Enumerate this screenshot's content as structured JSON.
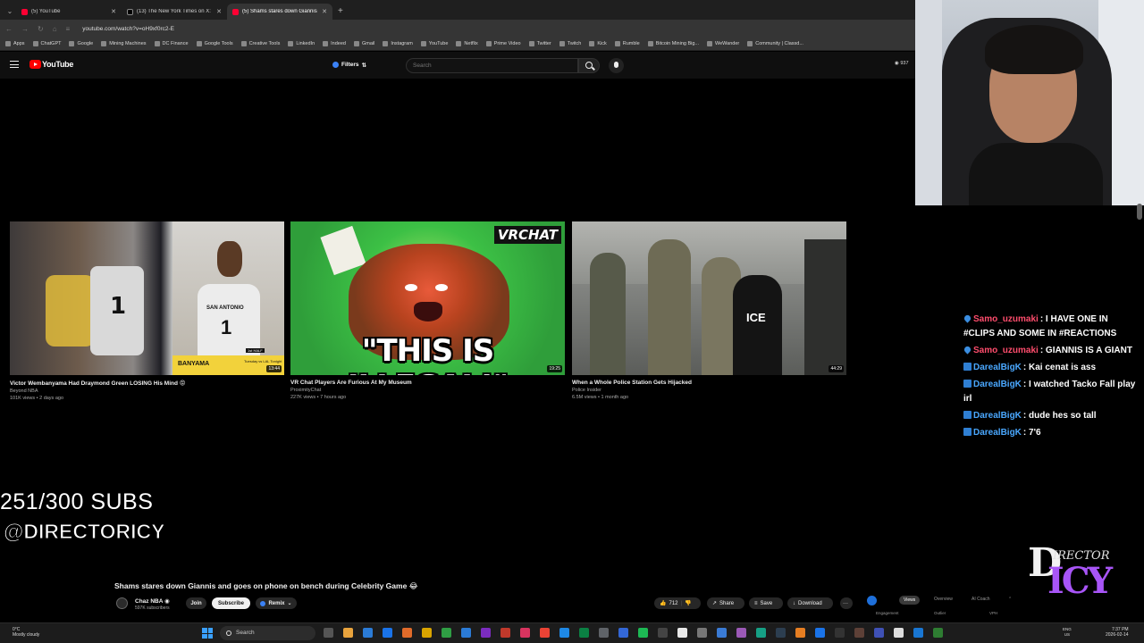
{
  "browser": {
    "tabs": [
      {
        "title": "(5) YouTube",
        "icon": "youtube-icon"
      },
      {
        "title": "(13) The New York Times on X:",
        "icon": "x-icon"
      },
      {
        "title": "(5) Shams stares down Giannis",
        "icon": "youtube-icon",
        "active": true
      }
    ],
    "url": "youtube.com/watch?v=oH9xf0rc2-E",
    "bookmarks": [
      "Apps",
      "ChatGPT",
      "Google",
      "Mining Machines",
      "DC Finance",
      "Google Tools",
      "Creative Tools",
      "LinkedIn",
      "Indeed",
      "Gmail",
      "Instagram",
      "YouTube",
      "Netflix",
      "Prime Video",
      "Twitter",
      "Twitch",
      "Kick",
      "Rumble",
      "Bitcoin Mining Big...",
      "WeWander",
      "Community | Classd..."
    ]
  },
  "youtube": {
    "logo_text": "YouTube",
    "filters_label": "Filters",
    "search_placeholder": "Search",
    "header_views": "937",
    "videos": [
      {
        "title": "Victor Wembanyama Had Draymond Green LOSING His Mind 😡",
        "channel": "Beyond NBA",
        "meta": "101K views • 2 days ago",
        "duration": "13:44",
        "thumb_number": "1",
        "thumb_team": "SAN ANTONIO",
        "thumb_banner": "BANYAMA",
        "thumb_sub": "Tuesday vs LAL Tonight",
        "thumb_half": "1st HALF"
      },
      {
        "title": "VR Chat Players Are Furious At My Museum",
        "channel": "ProximityChat",
        "meta": "227K views • 7 hours ago",
        "duration": "19:25",
        "thumb_tag": "VRCHAT",
        "thumb_text": "\"THIS IS ILLEGAL!\""
      },
      {
        "title": "When a Whole Police Station Gets Hijacked",
        "channel": "Police Insider",
        "meta": "6.5M views • 1 month ago",
        "duration": "44:29",
        "thumb_text": "ICE"
      }
    ],
    "now_playing": {
      "title": "Shams stares down Giannis and goes on phone on bench during Celebrity Game 😂",
      "channel": "Chaz NBA",
      "subscribers": "597K subscribers",
      "join_label": "Join",
      "subscribe_label": "Subscribe",
      "remix_label": "Remix",
      "likes": "712",
      "share_label": "Share",
      "save_label": "Save",
      "download_label": "Download",
      "more_label": "···"
    },
    "analytics": {
      "tabs": [
        "Views",
        "Overview",
        "AI Coach"
      ],
      "sub": [
        "Engagement",
        "Outlier",
        "VPH"
      ]
    }
  },
  "overlay": {
    "subs_goal": "251/300 SUBS",
    "handle": "@DIRECTORICY",
    "logo_text": "DIRECTOR ICY"
  },
  "chat": [
    {
      "user": "Samo_uzumaki",
      "color": "red",
      "badge": "blue-drop",
      "text": ": I HAVE ONE IN #CLIPS AND SOME IN #REACTIONS"
    },
    {
      "user": "Samo_uzumaki",
      "color": "red",
      "badge": "blue-drop",
      "text": ": GIANNIS IS A GIANT"
    },
    {
      "user": "DarealBigK",
      "color": "blue",
      "badge": "twbadge",
      "text": ": Kai cenat is ass"
    },
    {
      "user": "DarealBigK",
      "color": "blue",
      "badge": "twbadge",
      "text": ": I watched Tacko Fall play irl"
    },
    {
      "user": "DarealBigK",
      "color": "blue",
      "badge": "twbadge",
      "text": ": dude hes so tall"
    },
    {
      "user": "DarealBigK",
      "color": "blue",
      "badge": "twbadge",
      "text": ": 7'6"
    }
  ],
  "taskbar": {
    "weather_temp": "0°C",
    "weather_desc": "Mostly cloudy",
    "search_label": "Search",
    "lang": "ENG",
    "region": "US",
    "time": "7:37 PM",
    "date": "2026-02-14"
  },
  "colors": {
    "youtube_red": "#ff0000",
    "chat_red_user": "#ff4d6d",
    "chat_blue_user": "#4aa8ff",
    "logo_purple": "#a855f7"
  }
}
